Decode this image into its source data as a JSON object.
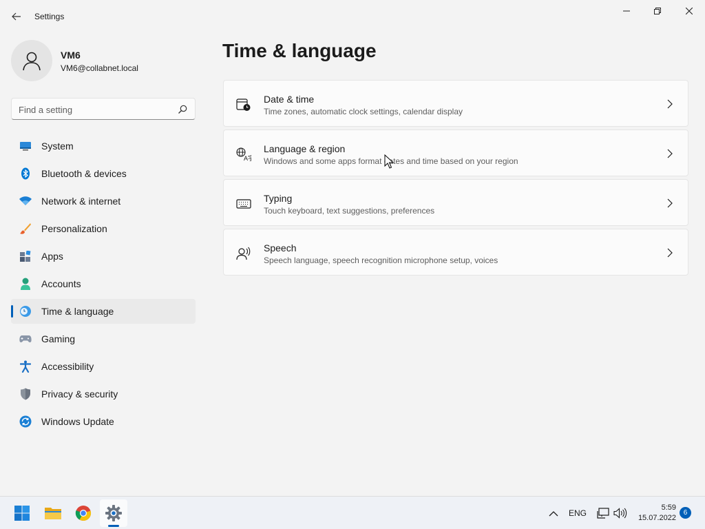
{
  "window": {
    "title": "Settings"
  },
  "profile": {
    "name": "VM6",
    "email": "VM6@collabnet.local"
  },
  "search": {
    "placeholder": "Find a setting"
  },
  "sidebar": {
    "items": [
      {
        "label": "System",
        "icon": "system-icon"
      },
      {
        "label": "Bluetooth & devices",
        "icon": "bluetooth-icon"
      },
      {
        "label": "Network & internet",
        "icon": "wifi-icon"
      },
      {
        "label": "Personalization",
        "icon": "brush-icon"
      },
      {
        "label": "Apps",
        "icon": "apps-icon"
      },
      {
        "label": "Accounts",
        "icon": "accounts-icon"
      },
      {
        "label": "Time & language",
        "icon": "time-language-icon",
        "selected": true
      },
      {
        "label": "Gaming",
        "icon": "gamepad-icon"
      },
      {
        "label": "Accessibility",
        "icon": "accessibility-icon"
      },
      {
        "label": "Privacy & security",
        "icon": "shield-icon"
      },
      {
        "label": "Windows Update",
        "icon": "update-icon"
      }
    ]
  },
  "main": {
    "title": "Time & language",
    "cards": [
      {
        "title": "Date & time",
        "description": "Time zones, automatic clock settings, calendar display",
        "icon": "calendar-clock-icon"
      },
      {
        "title": "Language & region",
        "description": "Windows and some apps format dates and time based on your region",
        "icon": "language-icon"
      },
      {
        "title": "Typing",
        "description": "Touch keyboard, text suggestions, preferences",
        "icon": "keyboard-icon"
      },
      {
        "title": "Speech",
        "description": "Speech language, speech recognition microphone setup, voices",
        "icon": "speech-icon"
      }
    ]
  },
  "taskbar": {
    "apps": [
      "start-icon",
      "file-explorer-icon",
      "chrome-icon",
      "settings-icon"
    ],
    "tray": {
      "language": "ENG",
      "time": "5:59",
      "date": "15.07.2022",
      "notification_count": "6"
    }
  },
  "colors": {
    "accent": "#005fb8",
    "background": "#f3f3f3",
    "card": "#fbfbfb"
  }
}
